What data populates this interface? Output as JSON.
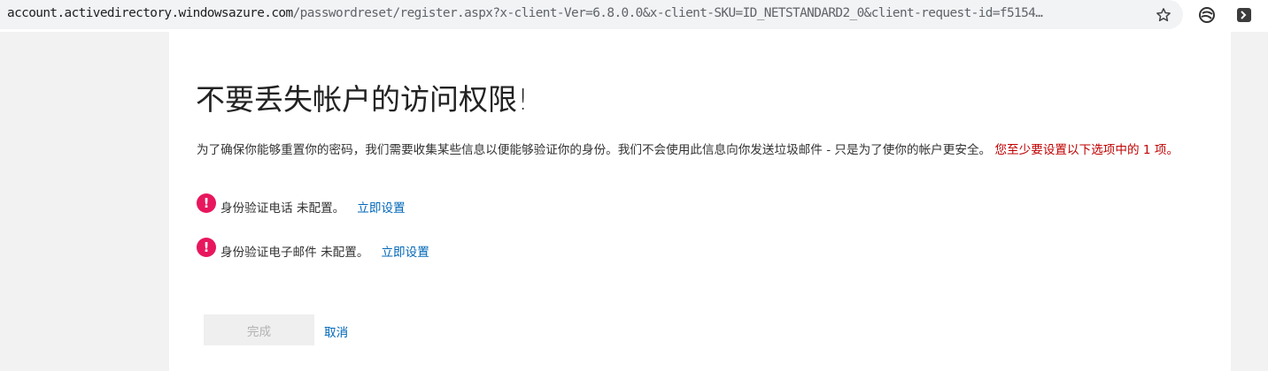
{
  "browser": {
    "url_host": "account.activedirectory.windowsazure.com",
    "url_rest": "/passwordreset/register.aspx?x-client-Ver=6.8.0.0&x-client-SKU=ID_NETSTANDARD2_0&client-request-id=f5154…",
    "icons": [
      "star-icon",
      "extension-icon",
      "terminal-extension-icon"
    ]
  },
  "page": {
    "title": "不要丢失帐户的访问权限!",
    "intro": "为了确保你能够重置你的密码，我们需要收集某些信息以便能够验证你的身份。我们不会使用此信息向你发送垃圾邮件 - 只是为了使你的帐户更安全。",
    "warning": "您至少要设置以下选项中的 1 项。",
    "methods": [
      {
        "label": "身份验证电话 未配置。",
        "action": "立即设置"
      },
      {
        "label": "身份验证电子邮件 未配置。",
        "action": "立即设置"
      }
    ],
    "finish_label": "完成",
    "cancel_label": "取消"
  },
  "colors": {
    "alert": "#e8175d",
    "link": "#0067b8",
    "warning": "#c00000"
  }
}
